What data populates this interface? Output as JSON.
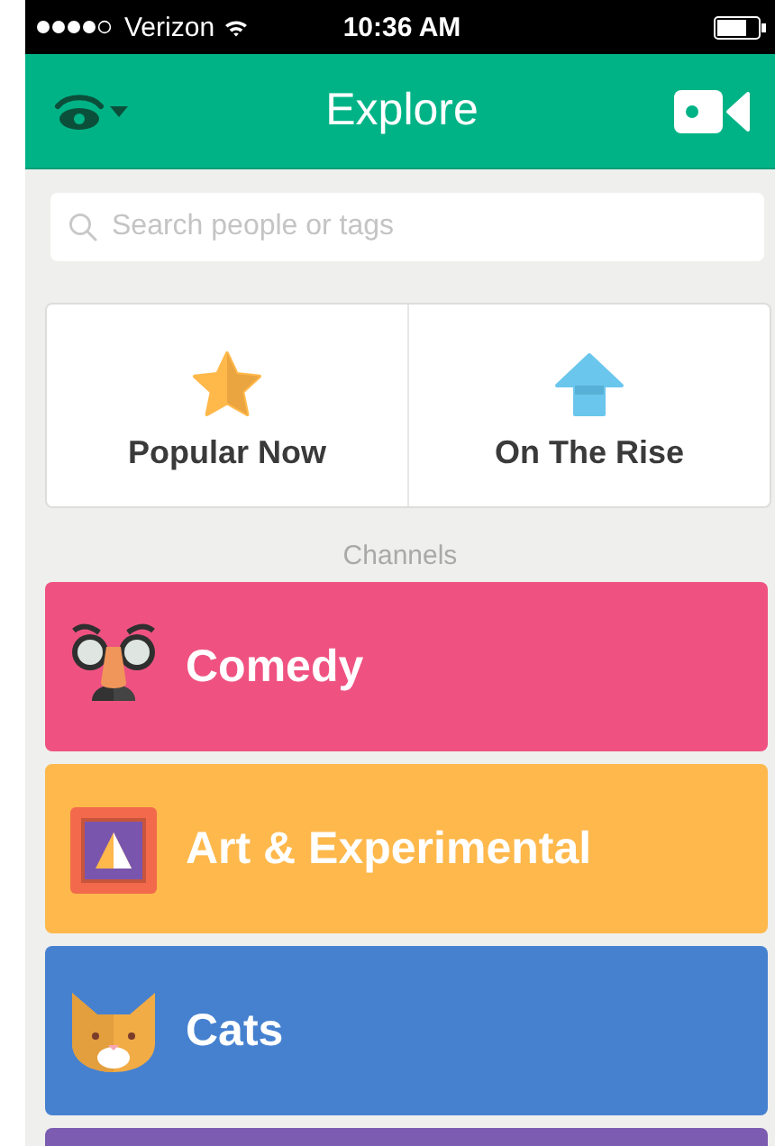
{
  "status_bar": {
    "carrier": "Verizon",
    "time": "10:36 AM"
  },
  "header": {
    "title": "Explore"
  },
  "search": {
    "placeholder": "Search people or tags"
  },
  "featured": [
    {
      "kind": "star",
      "label": "Popular Now"
    },
    {
      "kind": "arrow",
      "label": "On The Rise"
    }
  ],
  "channels_heading": "Channels",
  "channels": [
    {
      "kind": "comedy",
      "label": "Comedy",
      "color": "#ef5281"
    },
    {
      "kind": "art",
      "label": "Art & Experimental",
      "color": "#feb84b"
    },
    {
      "kind": "cats",
      "label": "Cats",
      "color": "#4681d0"
    },
    {
      "kind": "other",
      "color": "#7b5cb0"
    }
  ]
}
